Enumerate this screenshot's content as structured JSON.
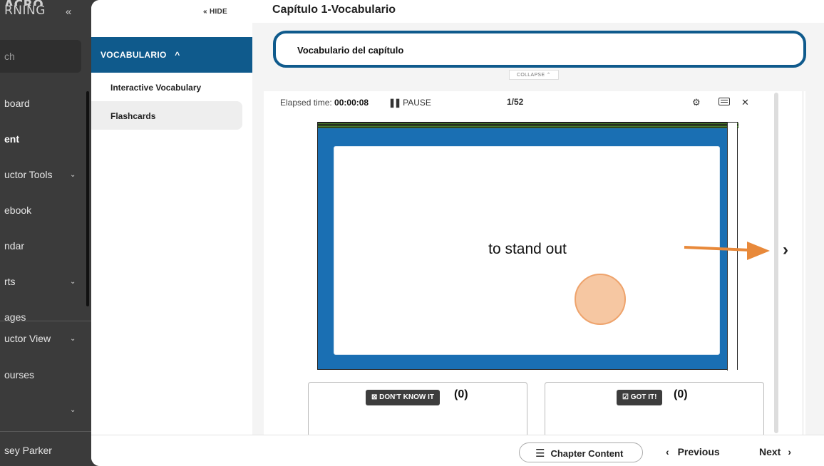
{
  "leftnav": {
    "logo_line1": "ACRO",
    "logo_line2": "RNING",
    "collapse_icon": "«",
    "search_placeholder": "ch",
    "items": [
      {
        "label": "board",
        "has_chevron": false
      },
      {
        "label": "ent",
        "has_chevron": false,
        "active": true
      },
      {
        "label": "uctor Tools",
        "has_chevron": true
      },
      {
        "label": "ebook",
        "has_chevron": false
      },
      {
        "label": "ndar",
        "has_chevron": false
      },
      {
        "label": "rts",
        "has_chevron": true
      },
      {
        "label": "ages",
        "has_chevron": false
      },
      {
        "label": "uctor View",
        "has_chevron": true
      },
      {
        "label": "ourses",
        "has_chevron": false
      },
      {
        "label": "",
        "has_chevron": true
      },
      {
        "label": "sey Parker",
        "has_chevron": false
      }
    ]
  },
  "subside": {
    "hide_label": "« HIDE",
    "section_label": "VOCABULARIO",
    "section_chevron": "^",
    "items": [
      "Interactive Vocabulary",
      "Flashcards"
    ]
  },
  "main": {
    "chapter_title": "Capítulo 1-Vocabulario",
    "box_title": "Vocabulario del capítulo",
    "collapse_label": "COLLAPSE ⌃"
  },
  "flashcards": {
    "elapsed_label": "Elapsed time:",
    "elapsed_value": "00:00:08",
    "pause_label": "PAUSE",
    "counter": "1/52",
    "word": "to stand out",
    "dont_know_label": "DON'T KNOW IT",
    "dont_know_count": "(0)",
    "got_it_label": "GOT IT!",
    "got_it_count": "(0)",
    "indicator_color": "#e8893a"
  },
  "bottombar": {
    "chapter_content_label": "Chapter Content",
    "previous_label": "Previous",
    "next_label": "Next"
  }
}
